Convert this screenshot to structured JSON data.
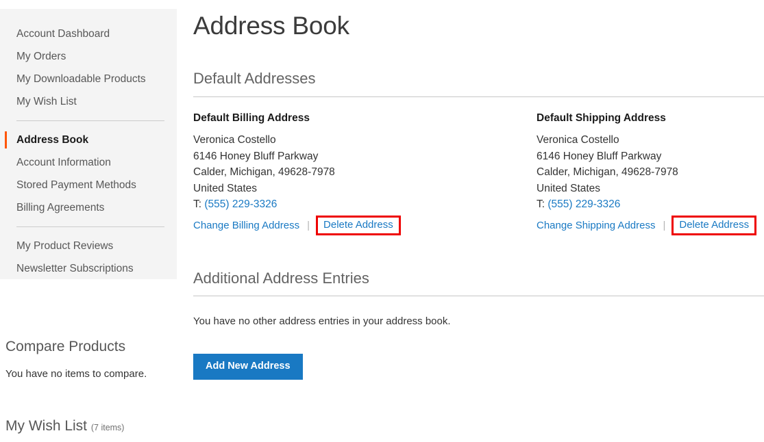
{
  "page": {
    "title": "Address Book"
  },
  "sidebar": {
    "groups": [
      {
        "items": [
          {
            "label": "Account Dashboard",
            "current": false
          },
          {
            "label": "My Orders",
            "current": false
          },
          {
            "label": "My Downloadable Products",
            "current": false
          },
          {
            "label": "My Wish List",
            "current": false
          }
        ]
      },
      {
        "items": [
          {
            "label": "Address Book",
            "current": true
          },
          {
            "label": "Account Information",
            "current": false
          },
          {
            "label": "Stored Payment Methods",
            "current": false
          },
          {
            "label": "Billing Agreements",
            "current": false
          }
        ]
      },
      {
        "items": [
          {
            "label": "My Product Reviews",
            "current": false
          },
          {
            "label": "Newsletter Subscriptions",
            "current": false
          }
        ]
      }
    ],
    "compare_widget": {
      "title": "Compare Products",
      "empty_text": "You have no items to compare."
    },
    "wishlist_widget": {
      "title": "My Wish List",
      "count_text": "(7 items)"
    }
  },
  "default_addresses": {
    "section_title": "Default Addresses",
    "billing": {
      "heading": "Default Billing Address",
      "name": "Veronica Costello",
      "street": "6146 Honey Bluff Parkway",
      "city_region_zip": "Calder, Michigan, 49628-7978",
      "country": "United States",
      "phone_prefix": "T:",
      "phone": "(555) 229-3326",
      "change_label": "Change Billing Address",
      "separator": "|",
      "delete_label": "Delete Address"
    },
    "shipping": {
      "heading": "Default Shipping Address",
      "name": "Veronica Costello",
      "street": "6146 Honey Bluff Parkway",
      "city_region_zip": "Calder, Michigan, 49628-7978",
      "country": "United States",
      "phone_prefix": "T:",
      "phone": "(555) 229-3326",
      "change_label": "Change Shipping Address",
      "separator": "|",
      "delete_label": "Delete Address"
    }
  },
  "additional_addresses": {
    "section_title": "Additional Address Entries",
    "empty_text": "You have no other address entries in your address book.",
    "add_button_label": "Add New Address"
  },
  "colors": {
    "accent_blue": "#1979c3",
    "active_marker_orange": "#ff5501",
    "highlight_red": "#ee0000",
    "sidebar_bg": "#f4f4f4"
  }
}
